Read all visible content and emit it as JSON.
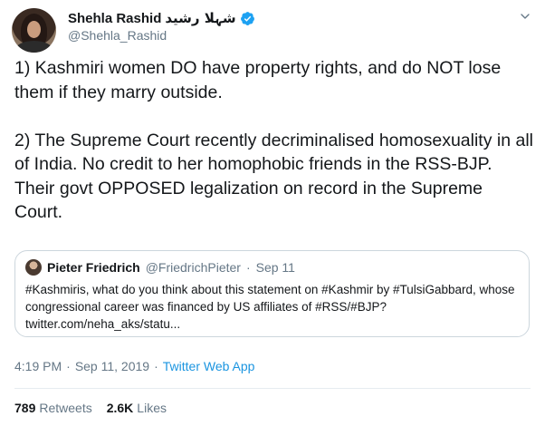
{
  "author": {
    "display_name": "Shehla Rashid",
    "urdu_name": "شہلا رشید",
    "handle": "@Shehla_Rashid",
    "verified_icon": "verified-badge-icon"
  },
  "tweet": {
    "text": "1) Kashmiri women DO have property rights, and do NOT lose them if they marry outside.\n\n2) The Supreme Court recently decriminalised homosexuality in all of India. No credit to her homophobic friends in the RSS-BJP. Their govt OPPOSED legalization on record in the Supreme Court."
  },
  "quote": {
    "name": "Pieter Friedrich",
    "handle": "@FriedrichPieter",
    "dot": "·",
    "date": "Sep 11",
    "text": "#Kashmiris, what do you think about this statement on #Kashmir by #TulsiGabbard, whose congressional career was financed by US affiliates of #RSS/#BJP? twitter.com/neha_aks/statu..."
  },
  "meta": {
    "time": "4:19 PM",
    "dot1": "·",
    "date": "Sep 11, 2019",
    "dot2": "·",
    "source": "Twitter Web App"
  },
  "stats": {
    "retweets_count": "789",
    "retweets_label": "Retweets",
    "likes_count": "2.6K",
    "likes_label": "Likes"
  },
  "colors": {
    "accent": "#1b95e0",
    "secondary_text": "#657786",
    "border": "#ccd6dd"
  }
}
